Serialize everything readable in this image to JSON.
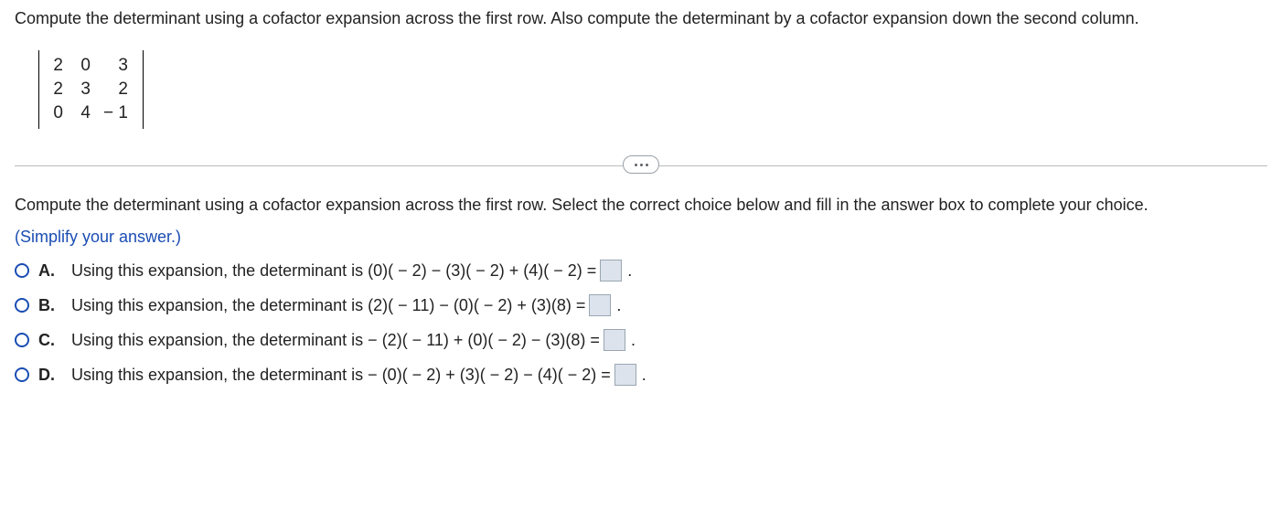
{
  "question": "Compute the determinant using a cofactor expansion across the first row. Also compute the determinant by a cofactor expansion down the second column.",
  "matrix": {
    "r0c0": "2",
    "r0c1": "0",
    "r0c2": "3",
    "r1c0": "2",
    "r1c1": "3",
    "r1c2": "2",
    "r2c0": "0",
    "r2c1": "4",
    "r2c2": "− 1"
  },
  "prompt2": "Compute the determinant using a cofactor expansion across the first row. Select the correct choice below and fill in the answer box to complete your choice.",
  "hint": "(Simplify your answer.)",
  "choices": {
    "A": {
      "letter": "A.",
      "text": "Using this expansion, the determinant is (0)( − 2) − (3)( − 2) + (4)( − 2) =",
      "period": "."
    },
    "B": {
      "letter": "B.",
      "text": "Using this expansion, the determinant is (2)( − 11) − (0)( − 2) + (3)(8) =",
      "period": "."
    },
    "C": {
      "letter": "C.",
      "text": "Using this expansion, the determinant is  − (2)( − 11) + (0)( − 2) − (3)(8) =",
      "period": "."
    },
    "D": {
      "letter": "D.",
      "text": "Using this expansion, the determinant is  − (0)( − 2) + (3)( − 2) − (4)( − 2) =",
      "period": "."
    }
  }
}
